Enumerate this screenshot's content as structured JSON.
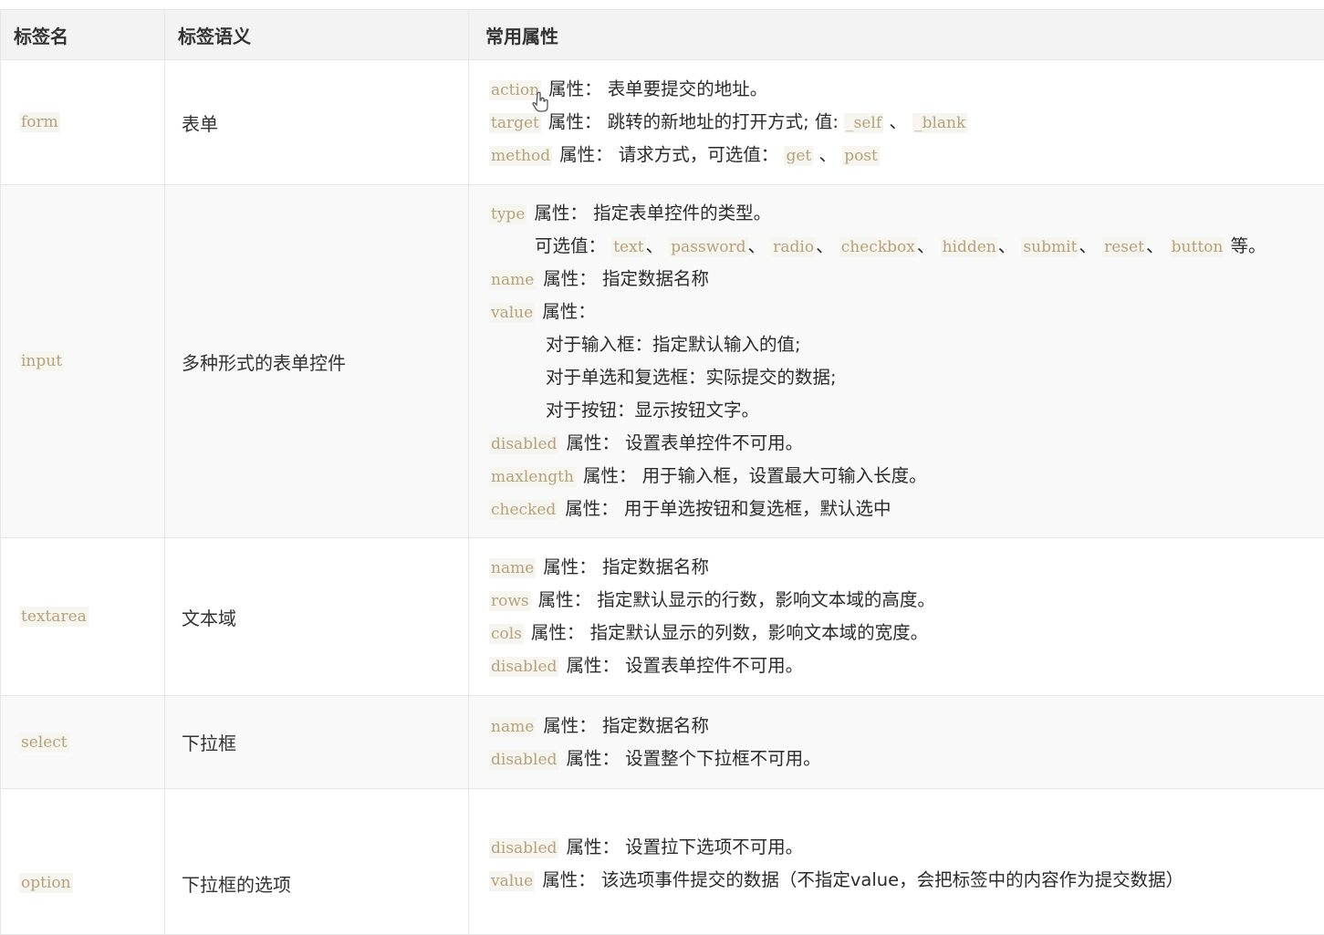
{
  "header": {
    "col_tag": "标签名",
    "col_semantics": "标签语义",
    "col_attrs": "常用属性"
  },
  "rows": [
    {
      "tag": "form",
      "semantics": "表单",
      "lines": [
        {
          "code": "action",
          "text": "属性： 表单要提交的地址。"
        },
        {
          "code": "target",
          "text": "属性： 跳转的新地址的打开方式; 值:",
          "values": [
            "_self",
            "_blank"
          ]
        },
        {
          "code": "method",
          "text": "属性： 请求方式，可选值：",
          "values": [
            "get",
            "post"
          ]
        }
      ]
    },
    {
      "tag": "input",
      "semantics": "多种形式的表单控件",
      "lines": [
        {
          "code": "type",
          "text": "属性： 指定表单控件的类型。"
        },
        {
          "text": "可选值：",
          "values": [
            "text",
            "password",
            "radio",
            "checkbox",
            "hidden",
            "submit",
            "reset",
            "button"
          ],
          "suffix": "等。"
        },
        {
          "code": "name",
          "text": "属性： 指定数据名称"
        },
        {
          "code": "value",
          "text": "属性："
        },
        {
          "text": "对于输入框：指定默认输入的值;"
        },
        {
          "text": "对于单选和复选框：实际提交的数据;"
        },
        {
          "text": "对于按钮：显示按钮文字。"
        },
        {
          "code": "disabled",
          "text": "属性： 设置表单控件不可用。"
        },
        {
          "code": "maxlength",
          "text": "属性： 用于输入框，设置最大可输入长度。"
        },
        {
          "code": "checked",
          "text": "属性： 用于单选按钮和复选框，默认选中"
        }
      ]
    },
    {
      "tag": "textarea",
      "semantics": "文本域",
      "lines": [
        {
          "code": "name",
          "text": "属性： 指定数据名称"
        },
        {
          "code": "rows",
          "text": "属性： 指定默认显示的行数，影响文本域的高度。"
        },
        {
          "code": "cols",
          "text": "属性： 指定默认显示的列数，影响文本域的宽度。"
        },
        {
          "code": "disabled",
          "text": "属性： 设置表单控件不可用。"
        }
      ]
    },
    {
      "tag": "select",
      "semantics": "下拉框",
      "lines": [
        {
          "code": "name",
          "text": "属性： 指定数据名称"
        },
        {
          "code": "disabled",
          "text": "属性： 设置整个下拉框不可用。"
        }
      ]
    },
    {
      "tag": "option",
      "semantics": "下拉框的选项",
      "lines": [
        {
          "code": "disabled",
          "text": "属性： 设置拉下选项不可用。"
        },
        {
          "code": "value",
          "text": "属性： 该选项事件提交的数据（不指定value，会把标签中的内容作为提交数据）"
        }
      ]
    }
  ],
  "separator": "、",
  "colors": {
    "code_text": "#b5a27a",
    "code_bg": "#f7f5f0",
    "header_bg": "#f3f3f3",
    "border": "#e6e6e6"
  }
}
